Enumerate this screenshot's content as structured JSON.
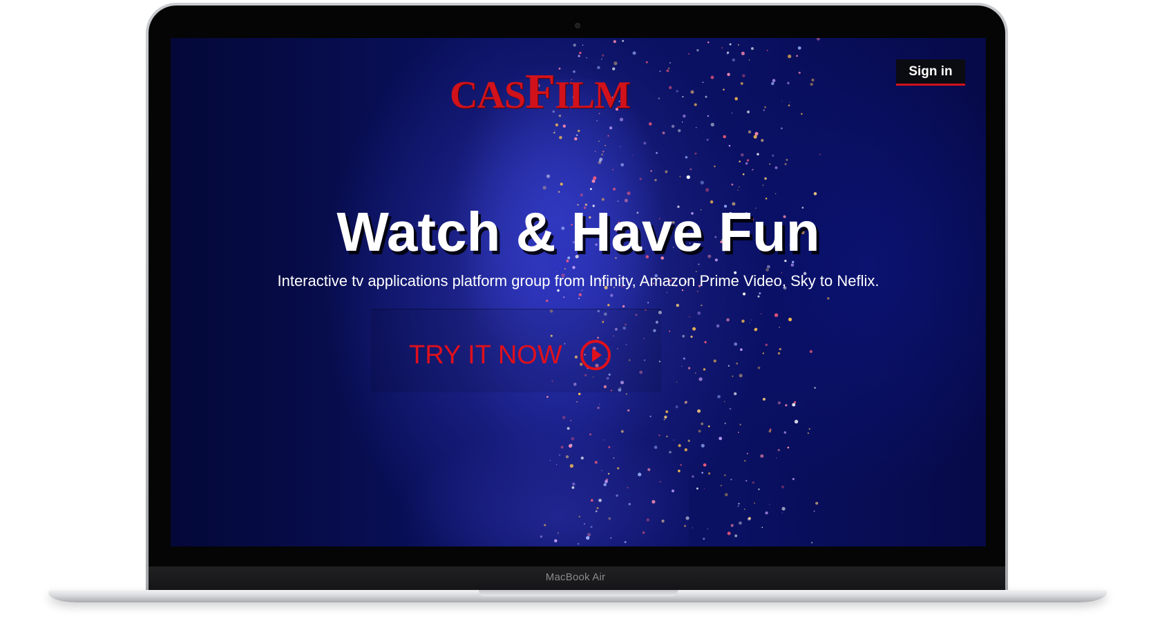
{
  "device": {
    "label": "MacBook Air"
  },
  "header": {
    "logo": {
      "part1": "CAS",
      "part2": "F",
      "part3": "ILM"
    },
    "signin_label": "Sign in"
  },
  "hero": {
    "headline": "Watch & Have Fun",
    "subheadline": "Interactive tv applications platform group from Infinity, Amazon Prime Video, Sky to Neflix.",
    "cta_label": "TRY IT NOW",
    "cta_icon": "play-circle-icon"
  },
  "colors": {
    "accent": "#d1121b",
    "background": "#0a1062",
    "text": "#ffffff"
  }
}
